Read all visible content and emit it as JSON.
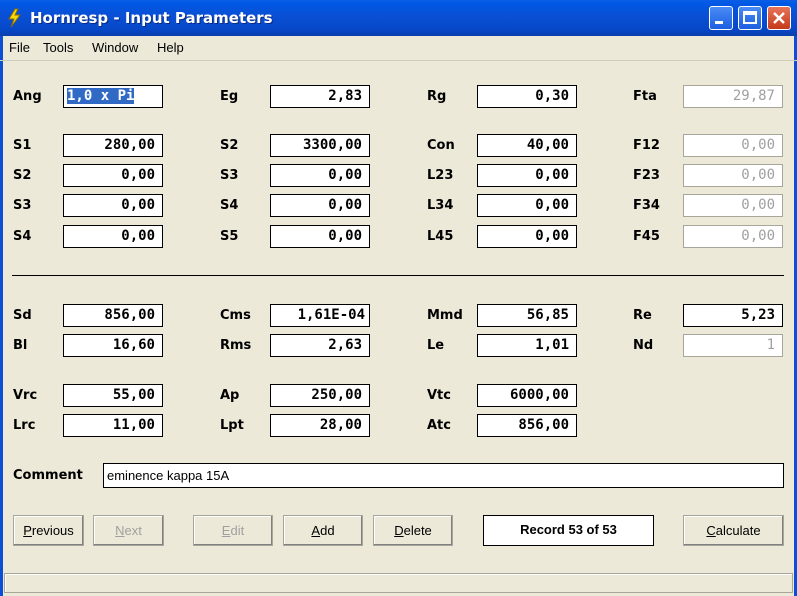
{
  "window": {
    "title": "Hornresp - Input Parameters"
  },
  "menu": [
    "File",
    "Tools",
    "Window",
    "Help"
  ],
  "params": {
    "Ang": {
      "label": "Ang",
      "value": "1,0 x Pi"
    },
    "Eg": {
      "label": "Eg",
      "value": "2,83"
    },
    "Rg": {
      "label": "Rg",
      "value": "0,30"
    },
    "Fta": {
      "label": "Fta",
      "value": "29,87"
    },
    "S1": {
      "label": "S1",
      "value": "280,00"
    },
    "S2a": {
      "label": "S2",
      "value": "3300,00"
    },
    "Con": {
      "label": "Con",
      "value": "40,00"
    },
    "F12": {
      "label": "F12",
      "value": "0,00"
    },
    "S2b": {
      "label": "S2",
      "value": "0,00"
    },
    "S3a": {
      "label": "S3",
      "value": "0,00"
    },
    "L23": {
      "label": "L23",
      "value": "0,00"
    },
    "F23": {
      "label": "F23",
      "value": "0,00"
    },
    "S3b": {
      "label": "S3",
      "value": "0,00"
    },
    "S4a": {
      "label": "S4",
      "value": "0,00"
    },
    "L34": {
      "label": "L34",
      "value": "0,00"
    },
    "F34": {
      "label": "F34",
      "value": "0,00"
    },
    "S4b": {
      "label": "S4",
      "value": "0,00"
    },
    "S5": {
      "label": "S5",
      "value": "0,00"
    },
    "L45": {
      "label": "L45",
      "value": "0,00"
    },
    "F45": {
      "label": "F45",
      "value": "0,00"
    },
    "Sd": {
      "label": "Sd",
      "value": "856,00"
    },
    "Cms": {
      "label": "Cms",
      "value": "1,61E-04"
    },
    "Mmd": {
      "label": "Mmd",
      "value": "56,85"
    },
    "Re": {
      "label": "Re",
      "value": "5,23"
    },
    "Bl": {
      "label": "Bl",
      "value": "16,60"
    },
    "Rms": {
      "label": "Rms",
      "value": "2,63"
    },
    "Le": {
      "label": "Le",
      "value": "1,01"
    },
    "Nd": {
      "label": "Nd",
      "value": "1"
    },
    "Vrc": {
      "label": "Vrc",
      "value": "55,00"
    },
    "Ap": {
      "label": "Ap",
      "value": "250,00"
    },
    "Vtc": {
      "label": "Vtc",
      "value": "6000,00"
    },
    "Lrc": {
      "label": "Lrc",
      "value": "11,00"
    },
    "Lpt": {
      "label": "Lpt",
      "value": "28,00"
    },
    "Atc": {
      "label": "Atc",
      "value": "856,00"
    }
  },
  "comment": {
    "label": "Comment",
    "value": "eminence kappa 15A"
  },
  "buttons": {
    "previous": {
      "pre": "",
      "u": "P",
      "post": "revious"
    },
    "next": {
      "pre": "",
      "u": "N",
      "post": "ext"
    },
    "edit": {
      "pre": "",
      "u": "E",
      "post": "dit"
    },
    "add": {
      "pre": "",
      "u": "A",
      "post": "dd"
    },
    "delete": {
      "pre": "",
      "u": "D",
      "post": "elete"
    },
    "calculate": {
      "pre": "",
      "u": "C",
      "post": "alculate"
    }
  },
  "record": "Record 53 of 53",
  "colors": {
    "titlebar": "#0a4fd4",
    "face": "#ece9d8",
    "disabled_text": "#a0a0a0",
    "selection": "#316ac5"
  }
}
